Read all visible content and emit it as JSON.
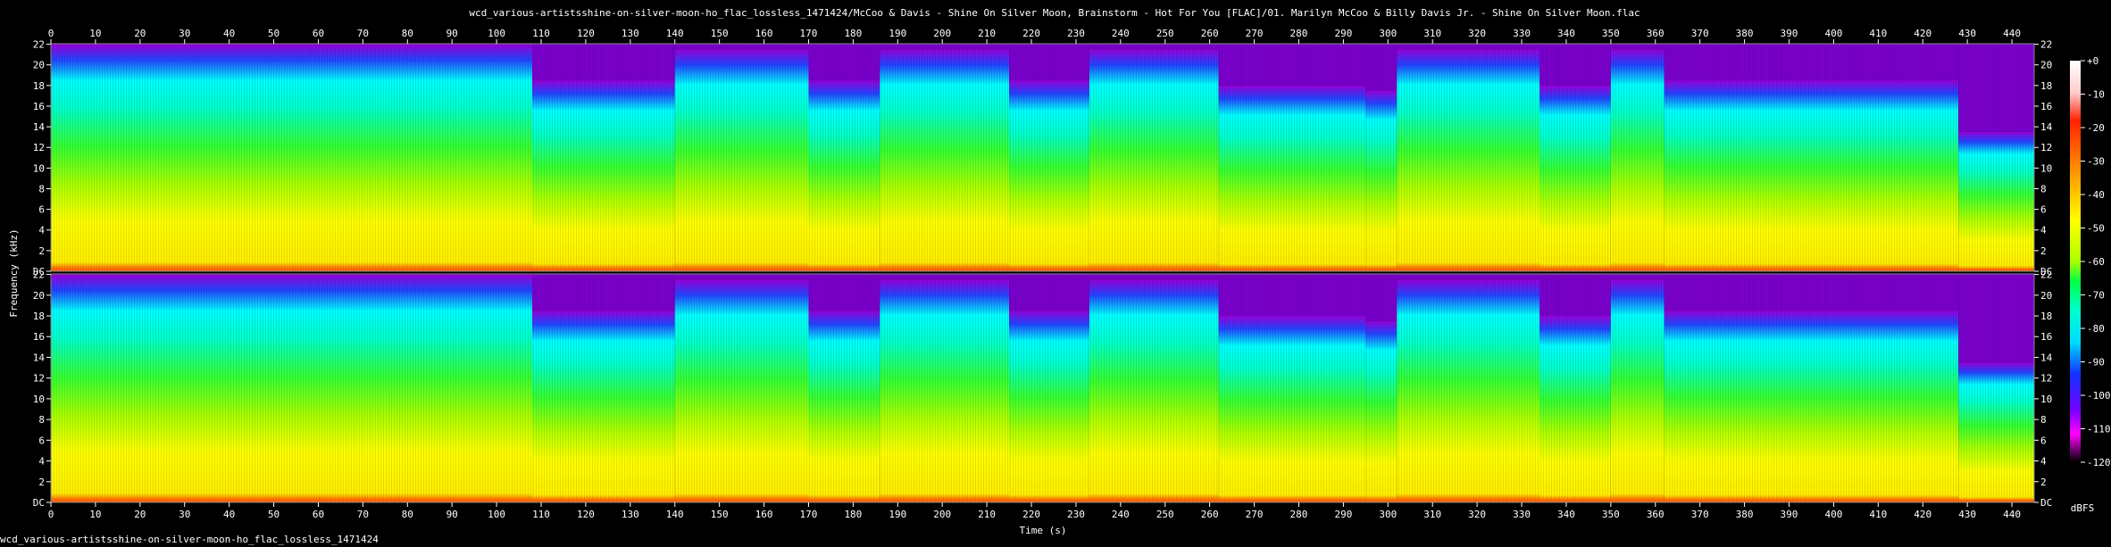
{
  "chart_data": {
    "type": "heatmap",
    "title": "wcd_various-artistsshine-on-silver-moon-ho_flac_lossless_1471424/McCoo & Davis - Shine On Silver Moon, Brainstorm - Hot For You [FLAC]/01. Marilyn McCoo & Billy Davis Jr. - Shine On Silver Moon.flac",
    "xlabel": "Time (s)",
    "ylabel": "Frequency (kHz)",
    "xlim": [
      0,
      445
    ],
    "ylim": [
      0,
      22.05
    ],
    "x_ticks": [
      "0",
      "10",
      "20",
      "30",
      "40",
      "50",
      "60",
      "70",
      "80",
      "90",
      "100",
      "110",
      "120",
      "130",
      "140",
      "150",
      "160",
      "170",
      "180",
      "190",
      "200",
      "210",
      "220",
      "230",
      "240",
      "250",
      "260",
      "270",
      "280",
      "290",
      "300",
      "310",
      "320",
      "330",
      "340",
      "350",
      "360",
      "370",
      "380",
      "390",
      "400",
      "410",
      "420",
      "430",
      "440"
    ],
    "y_ticks": [
      "DC",
      "2",
      "4",
      "6",
      "8",
      "10",
      "12",
      "14",
      "16",
      "18",
      "20",
      "22"
    ],
    "channels": 2,
    "colorbar": {
      "label": "dBFS",
      "ticks": [
        "+0",
        "-10",
        "-20",
        "-30",
        "-40",
        "-50",
        "-60",
        "-70",
        "-80",
        "-90",
        "-100",
        "-110",
        "-120"
      ],
      "range": [
        -120,
        0
      ]
    },
    "bandwidth_segments_khz": [
      {
        "t0": 0,
        "t1": 108,
        "top": 20.5
      },
      {
        "t0": 108,
        "t1": 140,
        "top": 17.0
      },
      {
        "t0": 140,
        "t1": 170,
        "top": 20.0
      },
      {
        "t0": 170,
        "t1": 186,
        "top": 17.0
      },
      {
        "t0": 186,
        "t1": 215,
        "top": 20.0
      },
      {
        "t0": 215,
        "t1": 233,
        "top": 17.0
      },
      {
        "t0": 233,
        "t1": 262,
        "top": 20.0
      },
      {
        "t0": 262,
        "t1": 295,
        "top": 16.5
      },
      {
        "t0": 295,
        "t1": 302,
        "top": 16.0
      },
      {
        "t0": 302,
        "t1": 334,
        "top": 20.0
      },
      {
        "t0": 334,
        "t1": 350,
        "top": 16.5
      },
      {
        "t0": 350,
        "t1": 362,
        "top": 20.0
      },
      {
        "t0": 362,
        "t1": 428,
        "top": 17.0
      },
      {
        "t0": 428,
        "t1": 445,
        "top": 12.0
      }
    ]
  },
  "footer": {
    "text": "wcd_various-artistsshine-on-silver-moon-ho_flac_lossless_1471424"
  }
}
